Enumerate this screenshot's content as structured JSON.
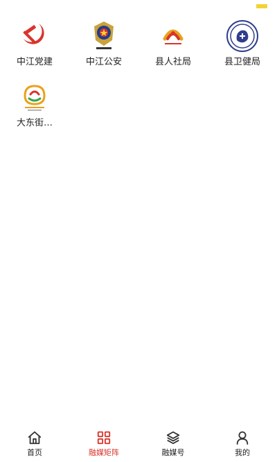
{
  "colors": {
    "accent": "#d9342b",
    "indicator": "#f2d336",
    "text": "#222222",
    "tab_inactive": "#333333"
  },
  "matrix": {
    "items": [
      {
        "label": "中江党建",
        "icon": "party-emblem-icon"
      },
      {
        "label": "中江公安",
        "icon": "police-badge-icon"
      },
      {
        "label": "县人社局",
        "icon": "human-resources-logo-icon"
      },
      {
        "label": "县卫健局",
        "icon": "health-bureau-seal-icon"
      },
      {
        "label": "大东街…",
        "icon": "dadong-street-logo-icon"
      }
    ]
  },
  "tabbar": {
    "tabs": [
      {
        "label": "首页",
        "icon": "home-icon",
        "active": false
      },
      {
        "label": "融媒矩阵",
        "icon": "grid-icon",
        "active": true
      },
      {
        "label": "融媒号",
        "icon": "layers-icon",
        "active": false
      },
      {
        "label": "我的",
        "icon": "user-icon",
        "active": false
      }
    ]
  }
}
